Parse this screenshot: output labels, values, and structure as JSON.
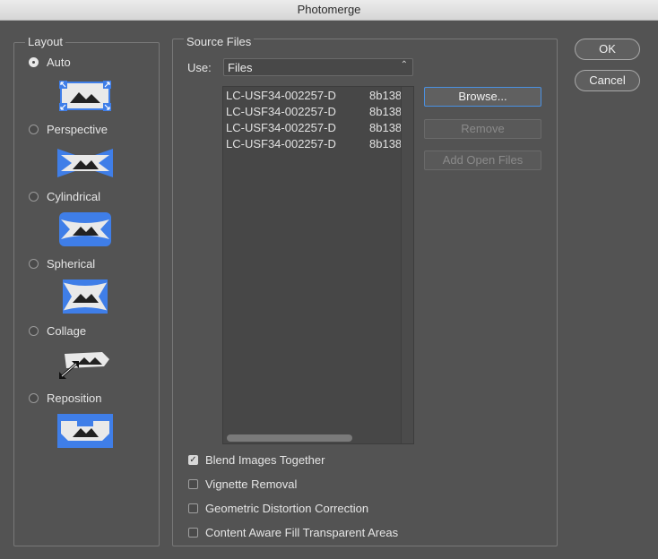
{
  "window": {
    "title": "Photomerge"
  },
  "layout": {
    "legend": "Layout",
    "options": [
      {
        "label": "Auto",
        "selected": true,
        "icon": "auto-layout-icon"
      },
      {
        "label": "Perspective",
        "selected": false,
        "icon": "perspective-layout-icon"
      },
      {
        "label": "Cylindrical",
        "selected": false,
        "icon": "cylindrical-layout-icon"
      },
      {
        "label": "Spherical",
        "selected": false,
        "icon": "spherical-layout-icon"
      },
      {
        "label": "Collage",
        "selected": false,
        "icon": "collage-layout-icon"
      },
      {
        "label": "Reposition",
        "selected": false,
        "icon": "reposition-layout-icon"
      }
    ]
  },
  "source": {
    "legend": "Source Files",
    "use_label": "Use:",
    "use_value": "Files",
    "files": [
      {
        "name": "LC-USF34-002257-D",
        "ext": "8b138"
      },
      {
        "name": "LC-USF34-002257-D",
        "ext": "8b138"
      },
      {
        "name": "LC-USF34-002257-D",
        "ext": "8b138"
      },
      {
        "name": "LC-USF34-002257-D",
        "ext": "8b138"
      }
    ],
    "browse": "Browse...",
    "remove": "Remove",
    "add_open": "Add Open Files"
  },
  "options": [
    {
      "label": "Blend Images Together",
      "checked": true
    },
    {
      "label": "Vignette Removal",
      "checked": false
    },
    {
      "label": "Geometric Distortion Correction",
      "checked": false
    },
    {
      "label": "Content Aware Fill Transparent Areas",
      "checked": false
    }
  ],
  "buttons": {
    "ok": "OK",
    "cancel": "Cancel"
  },
  "colors": {
    "accent": "#4a90e2",
    "icon_blue": "#3f7ee8",
    "icon_white": "#e9e9e9"
  }
}
